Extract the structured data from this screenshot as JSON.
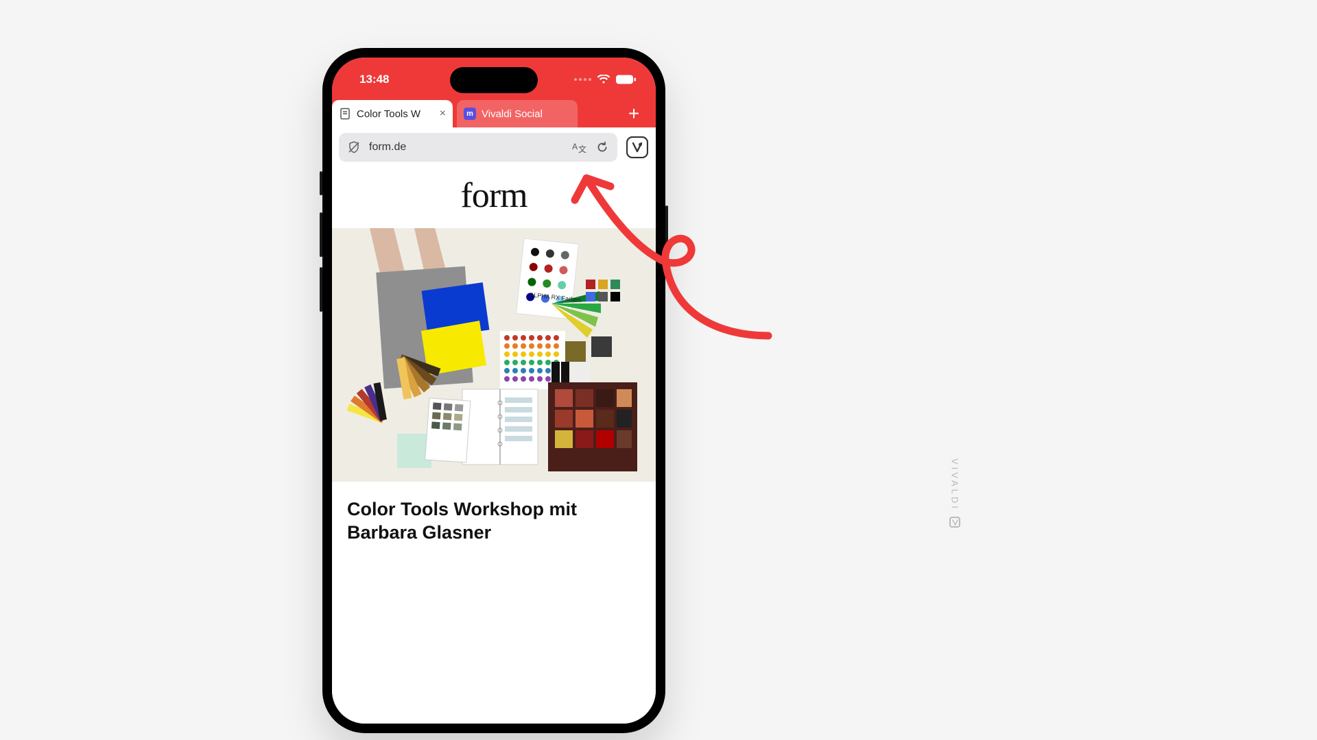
{
  "status": {
    "time": "13:48"
  },
  "tabs": {
    "active": {
      "label": "Color Tools W"
    },
    "inactive": {
      "label": "Vivaldi Social"
    }
  },
  "urlbar": {
    "domain": "form.de"
  },
  "page": {
    "site_logo": "form",
    "article_title": "Color Tools Workshop mit Barbara Glasner",
    "hero_caption": "ALPHA RX Farben"
  },
  "watermark": {
    "text": "VIVALDI"
  },
  "colors": {
    "accent": "#ef3939",
    "mastodon": "#5b4de0"
  }
}
